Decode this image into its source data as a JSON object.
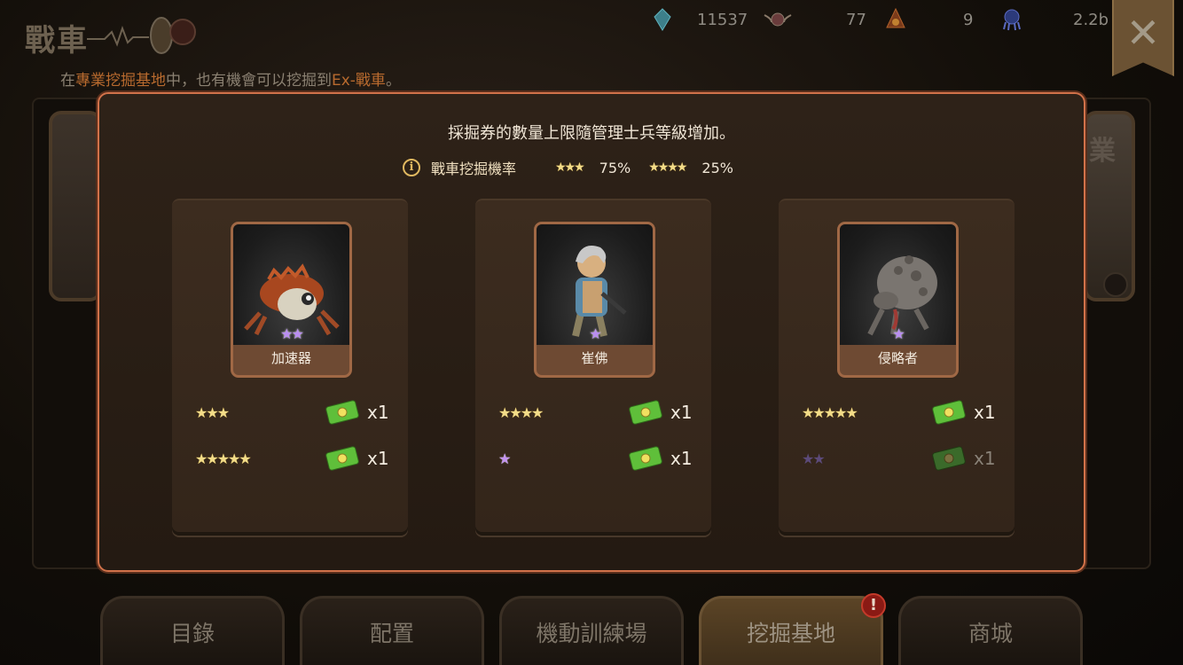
{
  "background": {
    "title": "戰車",
    "notice": {
      "prefix": "在",
      "place": "專業挖掘基地",
      "middle": "中，也有機會可以挖掘到",
      "item": "Ex-戰車",
      "suffix": "。"
    },
    "resources": [
      {
        "icon": "crystal-icon",
        "value": "11537"
      },
      {
        "icon": "wings-medal-icon",
        "value": "77"
      },
      {
        "icon": "flame-emblem-icon",
        "value": "9"
      },
      {
        "icon": "alien-icon",
        "value": "2.2b"
      }
    ],
    "right_card_glyph": "業",
    "close_glyph": "✕"
  },
  "tabs": [
    {
      "label": "目錄",
      "active": false
    },
    {
      "label": "配置",
      "active": false
    },
    {
      "label": "機動訓練場",
      "active": false
    },
    {
      "label": "挖掘基地",
      "active": true,
      "badge": "!"
    },
    {
      "label": "商城",
      "active": false
    }
  ],
  "modal": {
    "title": "採掘券的數量上限隨管理士兵等級增加。",
    "rate_label": "戰車挖掘機率",
    "rates": [
      {
        "stars": "★★★",
        "percent": "75%"
      },
      {
        "stars": "★★★★",
        "percent": "25%"
      }
    ],
    "cards": [
      {
        "name": "加速器",
        "portrait_stars": "★★",
        "portrait_icon": "crab-robot-icon",
        "rewards": [
          {
            "stars": "★★★",
            "color": "gold",
            "qty": "x1",
            "dim": false
          },
          {
            "stars": "★★★★★",
            "color": "gold",
            "qty": "x1",
            "dim": false
          }
        ]
      },
      {
        "name": "崔佛",
        "portrait_stars": "★",
        "portrait_icon": "soldier-icon",
        "rewards": [
          {
            "stars": "★★★★",
            "color": "gold",
            "qty": "x1",
            "dim": false
          },
          {
            "stars": "★",
            "color": "purple",
            "qty": "x1",
            "dim": false
          }
        ]
      },
      {
        "name": "侵略者",
        "portrait_stars": "★",
        "portrait_icon": "mutant-creature-icon",
        "rewards": [
          {
            "stars": "★★★★★",
            "color": "gold",
            "qty": "x1",
            "dim": false
          },
          {
            "stars": "★★",
            "color": "purple",
            "qty": "x1",
            "dim": true
          }
        ]
      }
    ]
  },
  "colors": {
    "modal_border": "#d2724a",
    "gold_star": "#f3dc88",
    "purple_star": "#c393f0",
    "ticket_green": "#5fbf3a",
    "highlight_orange": "#b86a2e"
  }
}
